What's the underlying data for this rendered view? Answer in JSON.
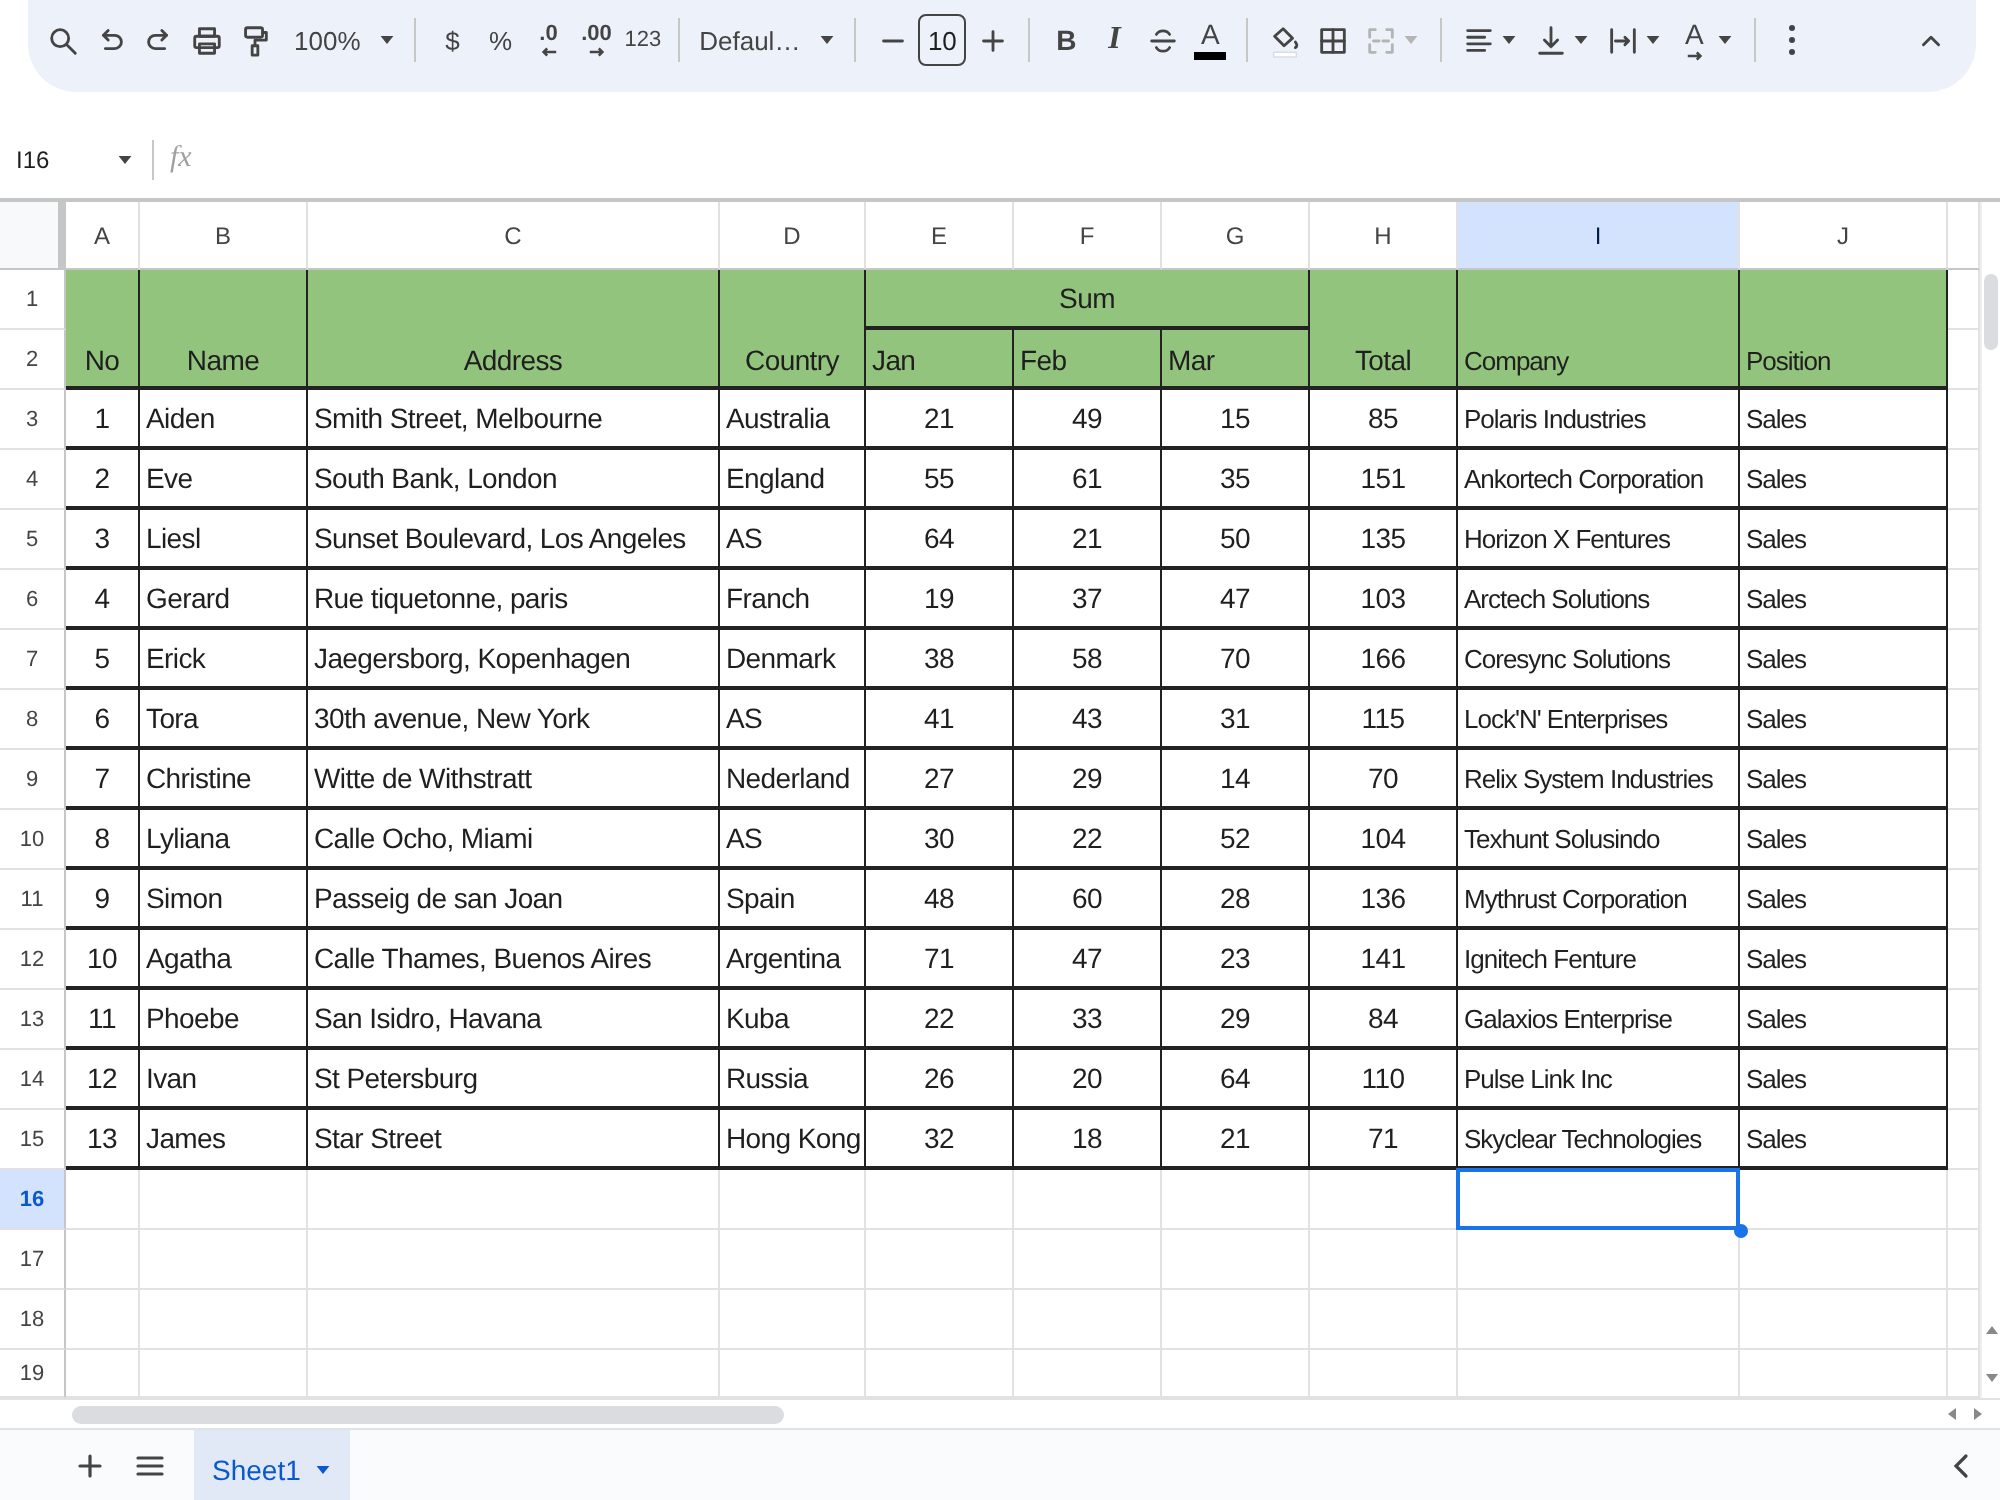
{
  "toolbar": {
    "zoom": "100%",
    "currency": "$",
    "percent": "%",
    "decrease_decimal": ".0",
    "increase_decimal": ".00",
    "number_format": "123",
    "font": "Defaul…",
    "font_size": "10",
    "bold": "B",
    "italic": "I",
    "text_color": "A",
    "text_rotation": "A",
    "merge_cells": {
      "disabled": true
    }
  },
  "formula_bar": {
    "cell_reference": "I16",
    "function_label": "fx"
  },
  "sheet": {
    "columns": [
      {
        "label": "A",
        "selected": false
      },
      {
        "label": "B",
        "selected": false
      },
      {
        "label": "C",
        "selected": false
      },
      {
        "label": "D",
        "selected": false
      },
      {
        "label": "E",
        "selected": false
      },
      {
        "label": "F",
        "selected": false
      },
      {
        "label": "G",
        "selected": false
      },
      {
        "label": "H",
        "selected": false
      },
      {
        "label": "I",
        "selected": true
      },
      {
        "label": "J",
        "selected": false
      }
    ],
    "row_headers": [
      {
        "label": "1",
        "selected": false
      },
      {
        "label": "2",
        "selected": false
      },
      {
        "label": "3",
        "selected": false
      },
      {
        "label": "4",
        "selected": false
      },
      {
        "label": "5",
        "selected": false
      },
      {
        "label": "6",
        "selected": false
      },
      {
        "label": "7",
        "selected": false
      },
      {
        "label": "8",
        "selected": false
      },
      {
        "label": "9",
        "selected": false
      },
      {
        "label": "10",
        "selected": false
      },
      {
        "label": "11",
        "selected": false
      },
      {
        "label": "12",
        "selected": false
      },
      {
        "label": "13",
        "selected": false
      },
      {
        "label": "14",
        "selected": false
      },
      {
        "label": "15",
        "selected": false
      },
      {
        "label": "16",
        "selected": true
      },
      {
        "label": "17",
        "selected": false
      },
      {
        "label": "18",
        "selected": false
      },
      {
        "label": "19",
        "selected": false
      }
    ],
    "table": {
      "header": [
        {
          "label": "No"
        },
        {
          "label": "Name"
        },
        {
          "label": "Address"
        },
        {
          "label": "Country"
        },
        {
          "label": "Sum",
          "children": [
            {
              "label": "Jan"
            },
            {
              "label": "Feb"
            },
            {
              "label": "Mar"
            }
          ]
        },
        {
          "label": "Total"
        },
        {
          "label": "Company"
        },
        {
          "label": "Position"
        }
      ],
      "rows": [
        [
          "1",
          "Aiden",
          "Smith Street, Melbourne",
          "Australia",
          "21",
          "49",
          "15",
          "85",
          "Polaris Industries",
          "Sales"
        ],
        [
          "2",
          "Eve",
          "South Bank, London",
          "England",
          "55",
          "61",
          "35",
          "151",
          "Ankortech Corporation",
          "Sales"
        ],
        [
          "3",
          "Liesl",
          "Sunset Boulevard, Los Angeles",
          "AS",
          "64",
          "21",
          "50",
          "135",
          "Horizon X Fentures",
          "Sales"
        ],
        [
          "4",
          "Gerard",
          "Rue tiquetonne, paris",
          "Franch",
          "19",
          "37",
          "47",
          "103",
          "Arctech Solutions",
          "Sales"
        ],
        [
          "5",
          "Erick",
          "Jaegersborg, Kopenhagen",
          "Denmark",
          "38",
          "58",
          "70",
          "166",
          "Coresync Solutions",
          "Sales"
        ],
        [
          "6",
          "Tora",
          "30th avenue, New York",
          "AS",
          "41",
          "43",
          "31",
          "115",
          "Lock'N' Enterprises",
          "Sales"
        ],
        [
          "7",
          "Christine",
          "Witte de Withstratt",
          "Nederland",
          "27",
          "29",
          "14",
          "70",
          "Relix System Industries",
          "Sales"
        ],
        [
          "8",
          "Lyliana",
          "Calle Ocho, Miami",
          "AS",
          "30",
          "22",
          "52",
          "104",
          "Texhunt Solusindo",
          "Sales"
        ],
        [
          "9",
          "Simon",
          "Passeig de san Joan",
          "Spain",
          "48",
          "60",
          "28",
          "136",
          "Mythrust Corporation",
          "Sales"
        ],
        [
          "10",
          "Agatha",
          "Calle Thames, Buenos Aires",
          "Argentina",
          "71",
          "47",
          "23",
          "141",
          "Ignitech Fenture",
          "Sales"
        ],
        [
          "11",
          "Phoebe",
          "San Isidro, Havana",
          "Kuba",
          "22",
          "33",
          "29",
          "84",
          "Galaxios Enterprise",
          "Sales"
        ],
        [
          "12",
          "Ivan",
          "St Petersburg",
          "Russia",
          "26",
          "20",
          "64",
          "110",
          "Pulse Link Inc",
          "Sales"
        ],
        [
          "13",
          "James",
          "Star Street",
          "Hong Kong",
          "32",
          "18",
          "21",
          "71",
          "Skyclear Technologies",
          "Sales"
        ]
      ]
    }
  },
  "sheet_tabs": [
    {
      "name": "Sheet1",
      "selected": true
    }
  ]
}
